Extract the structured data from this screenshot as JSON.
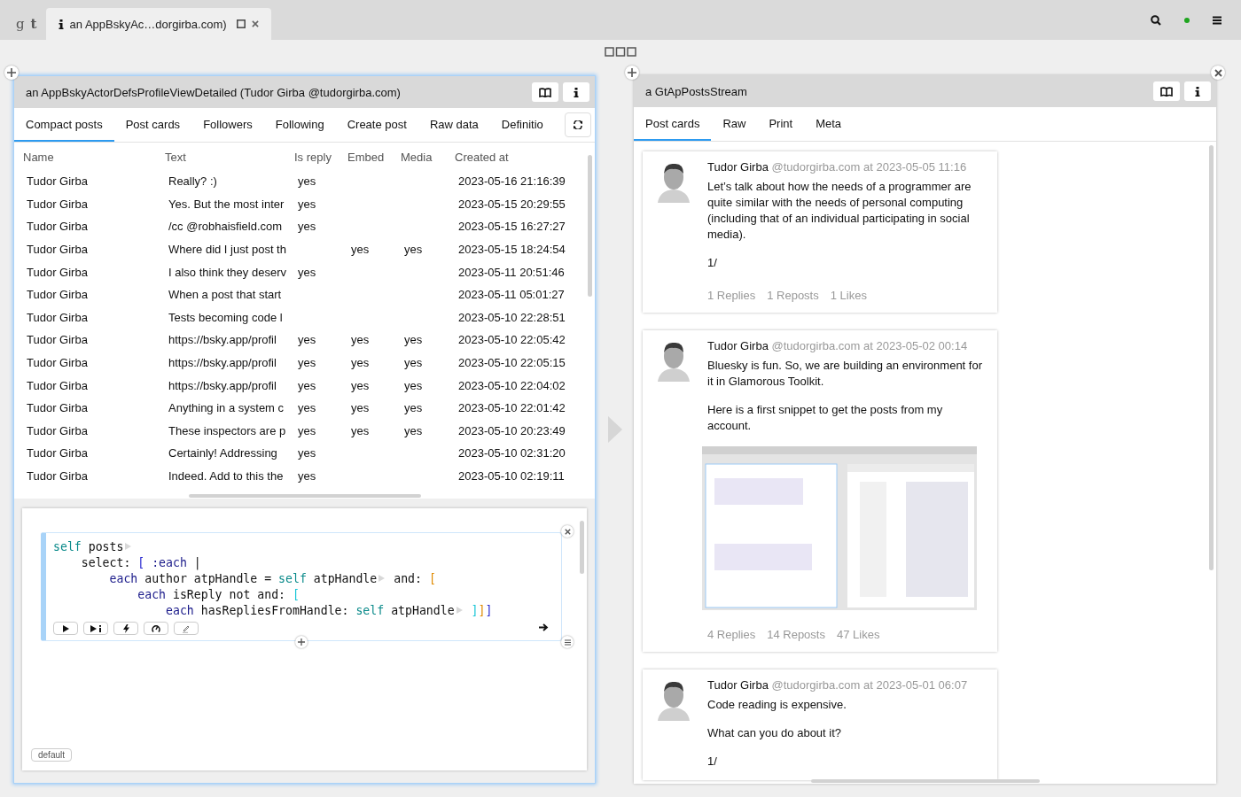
{
  "browser_tabs": [
    {
      "kind": "logo",
      "label": "g**t**",
      "selected": false
    },
    {
      "kind": "inspector",
      "label": "an AppBskyAc…dorgirba.com)",
      "selected": true
    }
  ],
  "left_pane": {
    "title": "an AppBskyActorDefsProfileViewDetailed (Tudor Girba @tudorgirba.com)",
    "focused": true,
    "tabs": [
      {
        "label": "Compact posts",
        "selected": true
      },
      {
        "label": "Post cards",
        "selected": false
      },
      {
        "label": "Followers",
        "selected": false
      },
      {
        "label": "Following",
        "selected": false
      },
      {
        "label": "Create post",
        "selected": false
      },
      {
        "label": "Raw data",
        "selected": false
      },
      {
        "label": "Definitio",
        "selected": false
      }
    ],
    "table": {
      "columns": [
        "Name",
        "Text",
        "Is reply",
        "Embed",
        "Media",
        "Created at"
      ],
      "rows": [
        [
          "Tudor Girba",
          "Really? :)",
          "yes",
          "",
          "",
          "2023-05-16 21:16:39"
        ],
        [
          "Tudor Girba",
          "Yes. But the most inter",
          "yes",
          "",
          "",
          "2023-05-15 20:29:55"
        ],
        [
          "Tudor Girba",
          "/cc @robhaisfield.com",
          "yes",
          "",
          "",
          "2023-05-15 16:27:27"
        ],
        [
          "Tudor Girba",
          "Where did I just post th",
          "",
          "yes",
          "yes",
          "2023-05-15 18:24:54"
        ],
        [
          "Tudor Girba",
          "I also think they deserv",
          "yes",
          "",
          "",
          "2023-05-11 20:51:46"
        ],
        [
          "Tudor Girba",
          "When a post that start",
          "",
          "",
          "",
          "2023-05-11 05:01:27"
        ],
        [
          "Tudor Girba",
          "Tests becoming code l",
          "",
          "",
          "",
          "2023-05-10 22:28:51"
        ],
        [
          "Tudor Girba",
          "https://bsky.app/profil",
          "yes",
          "yes",
          "yes",
          "2023-05-10 22:05:42"
        ],
        [
          "Tudor Girba",
          "https://bsky.app/profil",
          "yes",
          "yes",
          "yes",
          "2023-05-10 22:05:15"
        ],
        [
          "Tudor Girba",
          "https://bsky.app/profil",
          "yes",
          "yes",
          "yes",
          "2023-05-10 22:04:02"
        ],
        [
          "Tudor Girba",
          "Anything in a system c",
          "yes",
          "yes",
          "yes",
          "2023-05-10 22:01:42"
        ],
        [
          "Tudor Girba",
          "These inspectors are p",
          "yes",
          "yes",
          "yes",
          "2023-05-10 20:23:49"
        ],
        [
          "Tudor Girba",
          "Certainly!  Addressing",
          "yes",
          "",
          "",
          "2023-05-10 02:31:20"
        ],
        [
          "Tudor Girba",
          "Indeed. Add to this the",
          "yes",
          "",
          "",
          "2023-05-10 02:19:11"
        ]
      ]
    },
    "snippet": {
      "lines": [
        [
          {
            "kind": "self",
            "text": "self"
          },
          {
            "kind": "plain",
            "text": " posts"
          },
          {
            "kind": "expander"
          }
        ],
        [
          {
            "kind": "plain",
            "text": "    select: "
          },
          {
            "kind": "bracket",
            "text": "[",
            "color": "#2a2ad0"
          },
          {
            "kind": "var",
            "text": " :each"
          },
          {
            "kind": "plain",
            "text": " |"
          }
        ],
        [
          {
            "kind": "var",
            "text": "        each"
          },
          {
            "kind": "plain",
            "text": " author atpHandle = "
          },
          {
            "kind": "self",
            "text": "self"
          },
          {
            "kind": "plain",
            "text": " atpHandle"
          },
          {
            "kind": "expander"
          },
          {
            "kind": "plain",
            "text": " and: "
          },
          {
            "kind": "bracket",
            "text": "[",
            "color": "#e08a00"
          }
        ],
        [
          {
            "kind": "var",
            "text": "            each"
          },
          {
            "kind": "plain",
            "text": " isReply not and: "
          },
          {
            "kind": "bracket",
            "text": "[",
            "color": "#19c6d6"
          }
        ],
        [
          {
            "kind": "var",
            "text": "                each"
          },
          {
            "kind": "plain",
            "text": " hasRepliesFromHandle: "
          },
          {
            "kind": "self",
            "text": "self"
          },
          {
            "kind": "plain",
            "text": " atpHandle"
          },
          {
            "kind": "expander"
          },
          {
            "kind": "bracket",
            "text": " ]",
            "color": "#19c6d6"
          },
          {
            "kind": "bracket",
            "text": "]",
            "color": "#e08a00"
          },
          {
            "kind": "bracket",
            "text": "]",
            "color": "#2a2ad0"
          }
        ]
      ],
      "tag": "default"
    }
  },
  "right_pane": {
    "title": "a GtApPostsStream",
    "focused": false,
    "tabs": [
      {
        "label": "Post cards",
        "selected": true
      },
      {
        "label": "Raw",
        "selected": false
      },
      {
        "label": "Print",
        "selected": false
      },
      {
        "label": "Meta",
        "selected": false
      }
    ],
    "posts": [
      {
        "author": "Tudor Girba",
        "meta": "@tudorgirba.com at 2023-05-05 11:16",
        "paragraphs": [
          "Let’s talk about how the needs of a programmer are quite similar with the needs of personal computing (including that of an individual participating in social media).",
          "1/"
        ],
        "stats": [
          "1 Replies",
          "1 Reposts",
          "1 Likes"
        ]
      },
      {
        "author": "Tudor Girba",
        "meta": "@tudorgirba.com at 2023-05-02 00:14",
        "paragraphs": [
          "Bluesky is fun. So, we are building an environment for it in Glamorous Toolkit.",
          "Here is a first snippet to get the posts from my account."
        ],
        "media": {
          "kind": "picture"
        },
        "stats": [
          "4 Replies",
          "14 Reposts",
          "47 Likes"
        ]
      },
      {
        "author": "Tudor Girba",
        "meta": "@tudorgirba.com at 2023-05-01 06:07",
        "paragraphs": [
          "Code reading is expensive.",
          "What can you do about it?",
          "1/"
        ]
      }
    ]
  }
}
